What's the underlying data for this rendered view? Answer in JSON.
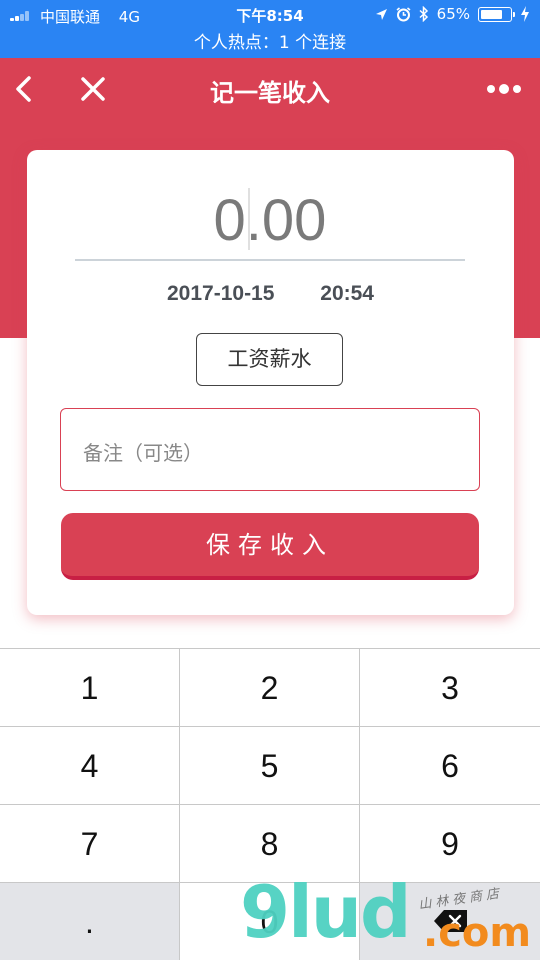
{
  "status_bar": {
    "carrier": "中国联通",
    "network": "4G",
    "time": "下午8:54",
    "battery": "65%",
    "battery_level": 0.65
  },
  "hotspot_banner": "个人热点：1 个连接",
  "nav": {
    "title": "记一笔收入",
    "back_icon": "chevron-left-icon",
    "close_icon": "close-icon",
    "more_icon": "more-dots-icon"
  },
  "form": {
    "amount": "0.00",
    "date": "2017-10-15",
    "time": "20:54",
    "category": "工资薪水",
    "note_placeholder": "备注（可选）",
    "save_label": "保存收入"
  },
  "keypad": {
    "rows": [
      [
        "1",
        "2",
        "3"
      ],
      [
        "4",
        "5",
        "6"
      ],
      [
        "7",
        "8",
        "9"
      ],
      [
        ".",
        "0",
        ""
      ]
    ],
    "backspace_icon": "backspace-icon"
  },
  "watermark": {
    "main": "9lud",
    "suffix": ".com",
    "small": "山林夜商店"
  },
  "colors": {
    "accent": "#d94154",
    "status_bar": "#2a84f3"
  }
}
